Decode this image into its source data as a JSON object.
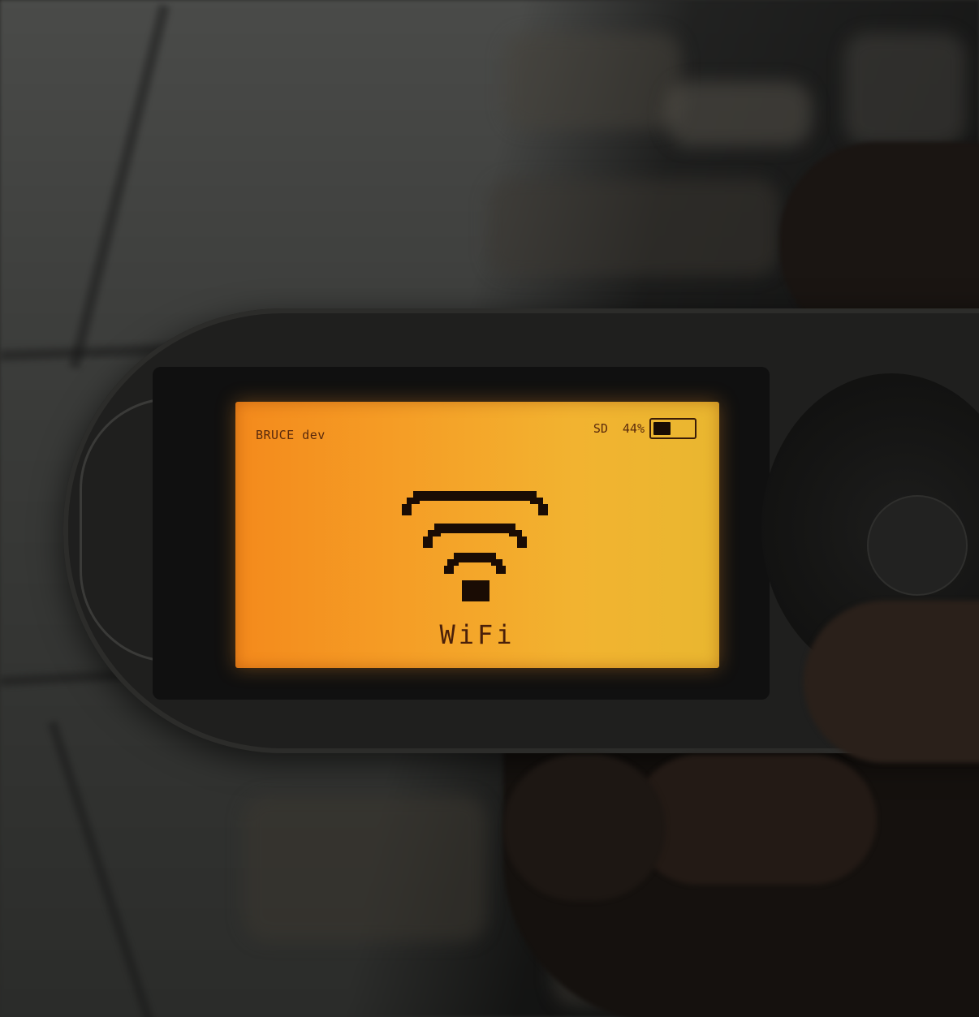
{
  "status_bar": {
    "device_name": "BRUCE dev",
    "sd_label": "SD",
    "battery_percent_text": "44%",
    "battery_level": 0.44
  },
  "menu": {
    "current_item": "WiFi",
    "icon": "wifi-icon"
  },
  "colors": {
    "lcd_backlight": "#f59e26",
    "lcd_ink": "#1a0c04"
  }
}
